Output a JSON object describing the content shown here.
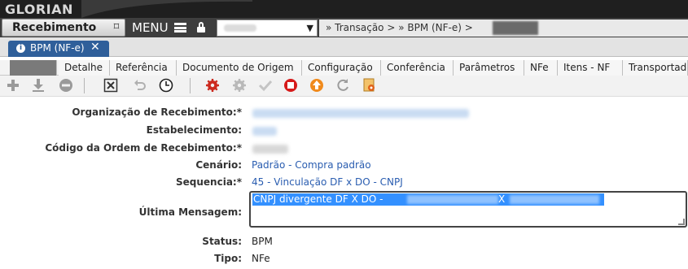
{
  "app": {
    "logo": "GLORIAN",
    "module_label": "Recebimento",
    "menu_label": "MENU"
  },
  "breadcrumb": {
    "text": "» Transação > » BPM (NF-e) >"
  },
  "document_tab": {
    "label": "BPM (NF-e)",
    "close": "✕"
  },
  "section_tabs": [
    {
      "label": ""
    },
    {
      "label": "Detalhe"
    },
    {
      "label": "Referência"
    },
    {
      "label": "Documento de Origem"
    },
    {
      "label": "Configuração"
    },
    {
      "label": "Conferência"
    },
    {
      "label": "Parâmetros"
    },
    {
      "label": "NFe"
    },
    {
      "label": "Itens - NF"
    },
    {
      "label": "Transportador"
    }
  ],
  "toolbar": {
    "icons": [
      "add-icon",
      "download-icon",
      "remove-icon",
      "cancel-icon",
      "undo-icon",
      "clock-icon",
      "gear-red-icon",
      "gear-gray-icon",
      "check-icon",
      "stop-icon",
      "up-arrow-icon",
      "refresh-icon",
      "settings-doc-icon"
    ]
  },
  "form": {
    "org_label": "Organização de Recebimento:*",
    "estab_label": "Estabelecimento:",
    "codigo_label": "Código da Ordem de Recebimento:*",
    "cenario_label": "Cenário:",
    "cenario_value": "Padrão - Compra padrão",
    "sequencia_label": "Sequencia:*",
    "sequencia_value": "45 - Vinculação DF x DO - CNPJ",
    "mensagem_label": "Última Mensagem:",
    "mensagem_value": "CNPJ divergente DF X DO -",
    "mensagem_mid": "X",
    "status_label": "Status:",
    "status_value": "BPM",
    "tipo_label": "Tipo:",
    "tipo_value": "NFe"
  },
  "colors": {
    "accent": "#2f5f9a",
    "link": "#2a5db0",
    "selection": "#3390ff"
  }
}
